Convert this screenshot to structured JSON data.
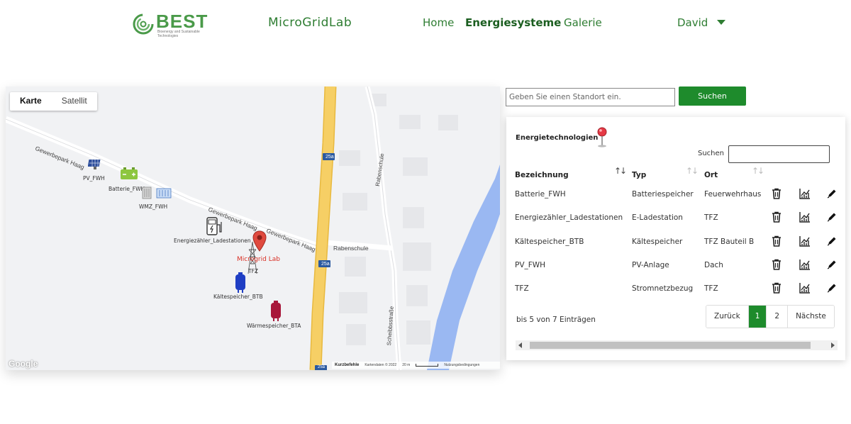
{
  "nav": {
    "logo_text": "BEST",
    "logo_subtitle": "Bioenergy and Sustainable Technologies",
    "brand": "MicroGridLab",
    "links": [
      "Home",
      "Energiesysteme",
      "Galerie"
    ],
    "active_link": "Energiesysteme",
    "user": "David"
  },
  "map": {
    "type_buttons": [
      "Karte",
      "Satellit"
    ],
    "active_type": "Karte",
    "streets": {
      "gewerbepark_1": "Gewerbepark Haag",
      "gewerbepark_2": "Gewerbepark Haag",
      "gewerbepark_3": "Gewerbepark Haag",
      "rabenschule_1": "Rabenschule",
      "rabenschule_2": "Rabenschule",
      "scheibbs": "Scheibbsstraße",
      "route_1": "25a",
      "route_2": "25a",
      "route_3": "25a"
    },
    "markers": {
      "pv": "PV_FWH",
      "batterie": "Batterie_FWH",
      "wmz": "WMZ_FWH",
      "energiezaehler": "Energiezähler_Ladestationen",
      "microgrid": "Microgrid Lab",
      "tfz": "TFZ",
      "kaeltespeicher": "Kältespeicher_BTB",
      "waermespeicher": "Wärmespeicher_BTA"
    },
    "google": "Google",
    "attribution": {
      "shortcuts": "Kurzbefehle",
      "data": "Kartendaten © 2022",
      "scale": "20 m",
      "terms": "Nutzungsbedingungen"
    }
  },
  "search": {
    "placeholder": "Geben Sie einen Standort ein.",
    "button": "Suchen"
  },
  "panel": {
    "title": "Energietechnologien",
    "filter_label": "Suchen",
    "columns": [
      "Bezeichnung",
      "Typ",
      "Ort"
    ],
    "rows": [
      {
        "name": "Batterie_FWH",
        "type": "Batteriespeicher",
        "location": "Feuerwehrhaus"
      },
      {
        "name": "Energiezähler_Ladestationen",
        "type": "E-Ladestation",
        "location": "TFZ"
      },
      {
        "name": "Kältespeicher_BTB",
        "type": "Kältespeicher",
        "location": "TFZ Bauteil B"
      },
      {
        "name": "PV_FWH",
        "type": "PV-Anlage",
        "location": "Dach"
      },
      {
        "name": "TFZ",
        "type": "Stromnetzbezug",
        "location": "TFZ"
      }
    ],
    "info": "bis 5 von 7 Einträgen",
    "pagination": {
      "prev": "Zurück",
      "pages": [
        "1",
        "2"
      ],
      "current": "1",
      "next": "Nächste"
    }
  },
  "colors": {
    "brand_green": "#2e7d32",
    "button_green": "#1e8b2c",
    "road_yellow": "#f6cf65",
    "river_blue": "#9ab8f2",
    "marker_red": "#e04a3f"
  }
}
